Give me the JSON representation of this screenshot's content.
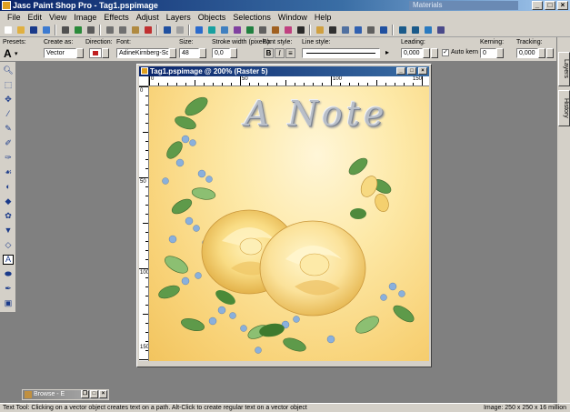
{
  "app": {
    "title": "Jasc Paint Shop Pro - Tag1.pspimage",
    "materials_title": "Materials"
  },
  "menu": [
    "File",
    "Edit",
    "View",
    "Image",
    "Effects",
    "Adjust",
    "Layers",
    "Objects",
    "Selections",
    "Window",
    "Help"
  ],
  "tool_options": {
    "presets_label": "Presets:",
    "create_as_label": "Create as:",
    "create_as_value": "Vector",
    "direction_label": "Direction:",
    "font_label": "Font:",
    "font_value": "AdineKirnberg-Scrip",
    "size_label": "Size:",
    "size_value": "48",
    "stroke_label": "Stroke width (pixels):",
    "stroke_value": "0,0",
    "font_style_label": "Font style:",
    "line_style_label": "Line style:",
    "leading_label": "Leading:",
    "leading_value": "0,000",
    "auto_kern_label": "Auto kern",
    "kerning_label": "Kerning:",
    "kerning_value": "0",
    "tracking_label": "Tracking:",
    "tracking_value": "0,000"
  },
  "palettes": {
    "layers_tab": "Layers",
    "history_tab": "History"
  },
  "document": {
    "title": "Tag1.pspimage @ 200% (Raster 5)",
    "canvas_text": "A Note",
    "ruler_top": [
      "0",
      "50",
      "100",
      "150"
    ],
    "ruler_left": [
      "0",
      "50",
      "100",
      "150"
    ]
  },
  "browse_window": {
    "title": "Browse - E"
  },
  "status": {
    "message": "Text Tool: Clicking on a vector object creates text on a path. Alt-Click to create regular text on a vector object",
    "image_info": "Image:  250 x 250 x 16 million"
  },
  "colors": {
    "title_gradient_start": "#0a246a",
    "title_gradient_end": "#a6caf0",
    "chrome": "#d4d0c8",
    "workspace": "#808080",
    "canvas_background": "#f8d277"
  }
}
